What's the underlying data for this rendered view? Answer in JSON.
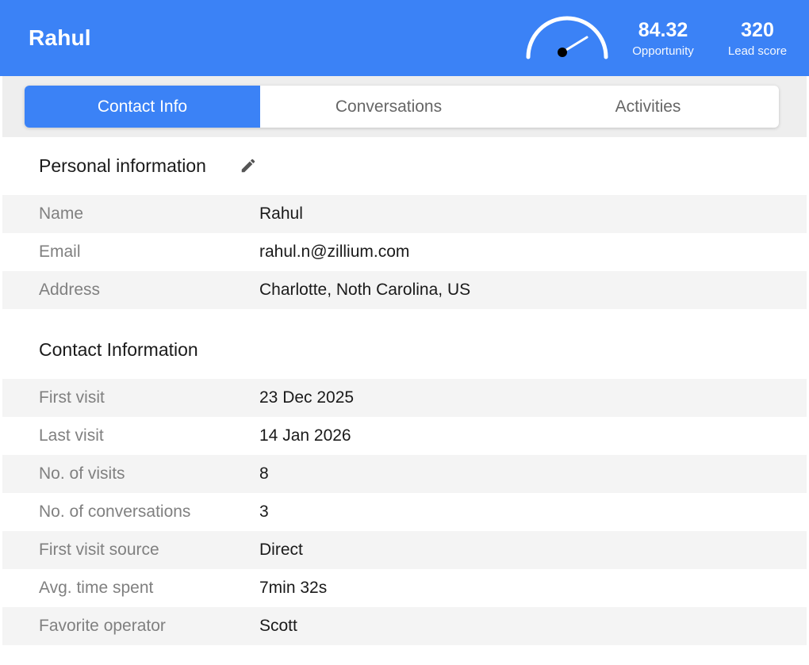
{
  "header": {
    "contact_name": "Rahul",
    "opportunity": {
      "value": "84.32",
      "label": "Opportunity"
    },
    "lead_score": {
      "value": "320",
      "label": "Lead score"
    },
    "accent_color": "#3b82f6"
  },
  "tabs": [
    {
      "label": "Contact Info",
      "active": true
    },
    {
      "label": "Conversations",
      "active": false
    },
    {
      "label": "Activities",
      "active": false
    }
  ],
  "personal": {
    "title": "Personal information",
    "edit_icon": "pencil-icon",
    "rows": [
      {
        "key": "Name",
        "value": "Rahul"
      },
      {
        "key": "Email",
        "value": "rahul.n@zillium.com"
      },
      {
        "key": "Address",
        "value": "Charlotte, Noth Carolina, US"
      }
    ]
  },
  "contact": {
    "title": "Contact Information",
    "rows": [
      {
        "key": "First visit",
        "value": "23 Dec 2025"
      },
      {
        "key": "Last visit",
        "value": "14 Jan 2026"
      },
      {
        "key": "No. of visits",
        "value": "8"
      },
      {
        "key": "No. of conversations",
        "value": "3"
      },
      {
        "key": "First visit source",
        "value": "Direct"
      },
      {
        "key": "Avg. time spent",
        "value": "7min 32s"
      },
      {
        "key": "Favorite operator",
        "value": "Scott"
      }
    ]
  }
}
